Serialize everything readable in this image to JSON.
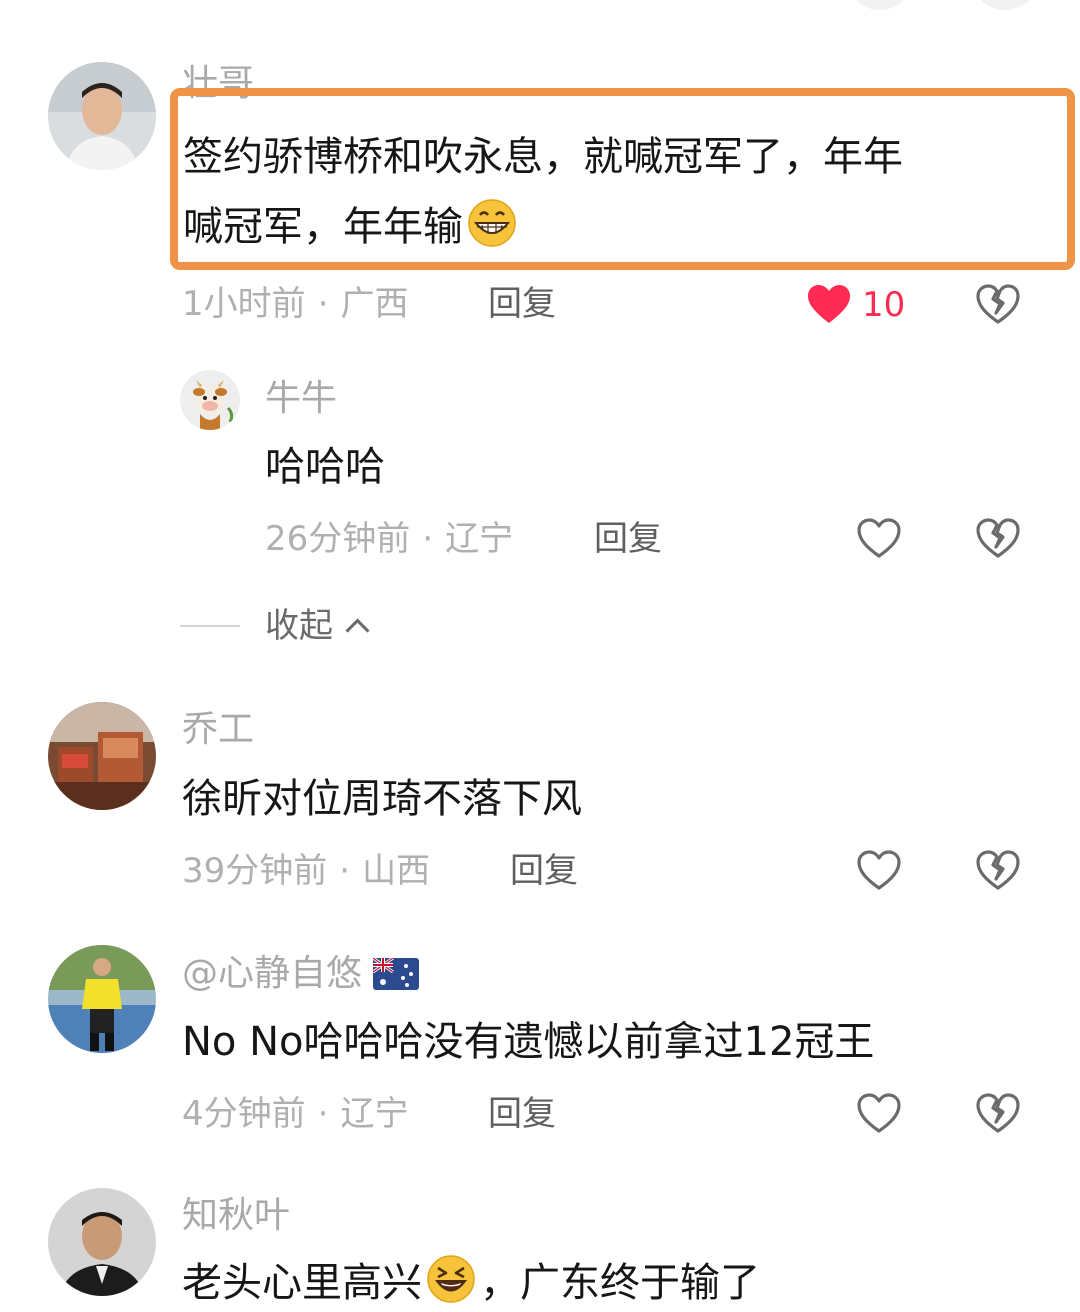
{
  "comments": [
    {
      "username": "壮哥",
      "text_line1": "签约骄博桥和吹永息，就喊冠军了，年年",
      "text_line2": "喊冠军，年年输",
      "emoji": "grinning-face",
      "time": "1小时前",
      "location": "广西",
      "reply_label": "回复",
      "likes": "10",
      "liked": true,
      "replies": [
        {
          "username": "牛牛",
          "text": "哈哈哈",
          "time": "26分钟前",
          "location": "辽宁",
          "reply_label": "回复"
        }
      ],
      "collapse_label": "收起"
    },
    {
      "username": "乔工",
      "text": "徐昕对位周琦不落下风",
      "time": "39分钟前",
      "location": "山西",
      "reply_label": "回复"
    },
    {
      "username": "@心静自悠",
      "flag": "australia-flag",
      "text": "No No哈哈哈没有遗憾以前拿过12冠王",
      "time": "4分钟前",
      "location": "辽宁",
      "reply_label": "回复"
    },
    {
      "username": "知秋叶",
      "text_before": "老头心里高兴",
      "emoji": "laughing-face",
      "text_after": "，广东终于输了"
    }
  ],
  "separator": "·",
  "colors": {
    "highlight_border": "#ef9446",
    "like_active": "#ff2b53",
    "meta_gray": "#b0b0b0"
  }
}
